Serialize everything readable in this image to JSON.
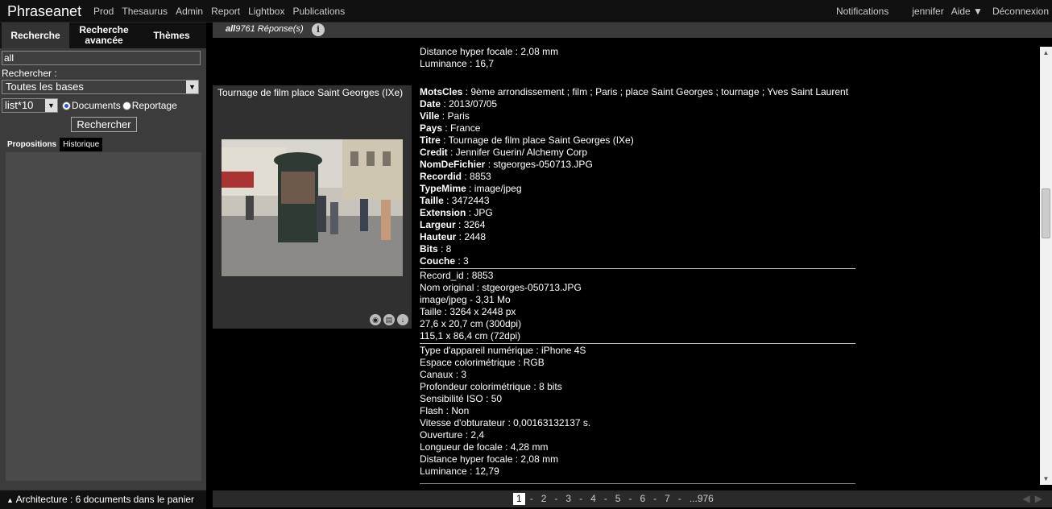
{
  "app": {
    "brand": "Phraseanet"
  },
  "topnav": {
    "items": [
      "Prod",
      "Thesaurus",
      "Admin",
      "Report",
      "Lightbox",
      "Publications"
    ],
    "right": {
      "notifications": "Notifications",
      "user": "jennifer",
      "help": "Aide ▼",
      "logout": "Déconnexion"
    }
  },
  "sidebar": {
    "tabs": [
      "Recherche",
      "Recherche avancée",
      "Thèmes"
    ],
    "search_value": "all",
    "search_label": "Rechercher :",
    "bases_select": "Toutes les bases",
    "list_select": "list*10",
    "radio_documents": "Documents",
    "radio_reportage": "Reportage",
    "search_button": "Rechercher",
    "subtabs": [
      "Propositions",
      "Historique"
    ],
    "basket": "Architecture : 6 documents dans le panier"
  },
  "results_header": {
    "query": "all",
    "count": "9761 Réponse(s)"
  },
  "previous_tail": [
    "Distance hyper focale : 2,08 mm",
    "Luminance : 16,7"
  ],
  "record": {
    "title": "Tournage de film place Saint Georges (IXe)",
    "fields": [
      {
        "label": "MotsCles",
        "value": " : 9ème arrondissement ; film ; Paris ; place Saint Georges ; tournage ; Yves Saint Laurent"
      },
      {
        "label": "Date",
        "value": " : 2013/07/05"
      },
      {
        "label": "Ville",
        "value": " : Paris"
      },
      {
        "label": "Pays",
        "value": " : France"
      },
      {
        "label": "Titre",
        "value": " : Tournage de film place Saint Georges (IXe)"
      },
      {
        "label": "Credit",
        "value": " : Jennifer Guerin/ Alchemy Corp"
      },
      {
        "label": "NomDeFichier",
        "value": " : stgeorges-050713.JPG"
      },
      {
        "label": "Recordid",
        "value": " : 8853"
      },
      {
        "label": "TypeMime",
        "value": " : image/jpeg"
      },
      {
        "label": "Taille",
        "value": " : 3472443"
      },
      {
        "label": "Extension",
        "value": " : JPG"
      },
      {
        "label": "Largeur",
        "value": " : 3264"
      },
      {
        "label": "Hauteur",
        "value": " : 2448"
      },
      {
        "label": "Bits",
        "value": " : 8"
      },
      {
        "label": "Couche",
        "value": " : 3"
      }
    ],
    "technical": [
      "Record_id : 8853",
      "Nom original : stgeorges-050713.JPG",
      "image/jpeg - 3,31 Mo",
      "Taille : 3264 x 2448 px",
      "27,6 x 20,7 cm (300dpi)",
      "115,1 x 86,4 cm (72dpi)"
    ],
    "exif": [
      "Type d'appareil numérique : iPhone 4S",
      "Espace colorimétrique : RGB",
      "Canaux : 3",
      "Profondeur colorimétrique : 8 bits",
      "Sensibilité ISO : 50",
      "Flash : Non",
      "Vitesse d'obturateur : 0,00163132137 s.",
      "Ouverture : 2,4",
      "Longueur de focale : 4,28 mm",
      "Distance hyper focale : 2,08 mm",
      "Luminance : 12,79"
    ]
  },
  "pagination": {
    "pages": [
      "1",
      "2",
      "3",
      "4",
      "5",
      "6",
      "7",
      "...976"
    ],
    "current": "1"
  }
}
